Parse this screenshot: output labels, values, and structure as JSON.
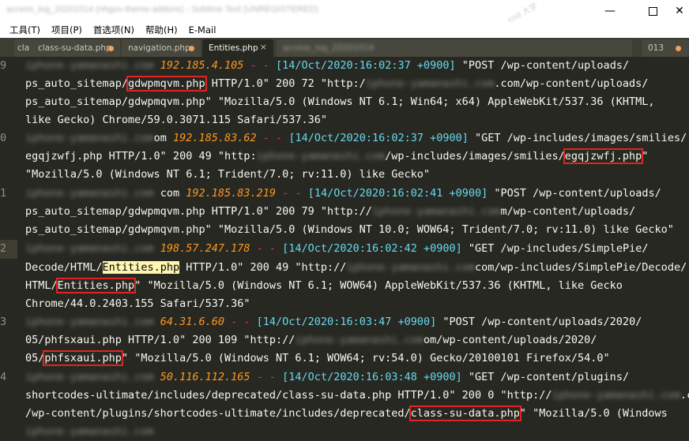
{
  "window": {
    "title": "access_log_20201014 (nhgov-theme-addons) - Sublime Text (UNREGISTERED)",
    "watermark": "ios8 大学"
  },
  "menu": {
    "items": [
      "工具(T)",
      "项目(P)",
      "首选项(N)",
      "帮助(H)",
      "E-Mail"
    ]
  },
  "tabs": [
    {
      "label": "cla",
      "state": "partial"
    },
    {
      "label": "class-su-data.php",
      "state": "modified"
    },
    {
      "label": "navigation.php",
      "state": "modified"
    },
    {
      "label": "Entities.php",
      "state": "active"
    },
    {
      "label": "access_log_20201014",
      "state": "blurred"
    },
    {
      "label": "013",
      "state": "partial"
    }
  ],
  "editor": {
    "line_numbers": [
      "9",
      "0",
      "1",
      "2",
      "3",
      "4"
    ],
    "blurred_host": "iphone-yamanashi.com",
    "entries": [
      {
        "ip": "192.185.4.105",
        "time": "[14/Oct/2020:16:02:37 +0900]",
        "l1_rest": " \"POST /wp-content/uploads/",
        "l2_pre": "ps_auto_sitemap/",
        "l2_box": "gdwpmqvm.php",
        "l2_post": " HTTP/1.0\" 200 72 \"http:/",
        "l2_tail": ".com/wp-content/uploads/",
        "l3": "ps_auto_sitemap/gdwpmqvm.php\" \"Mozilla/5.0 (Windows NT 6.1; Win64; x64) AppleWebKit/537.36 (KHTML,",
        "l4": "like Gecko) Chrome/59.0.3071.115 Safari/537.36\""
      },
      {
        "host_tail": "om",
        "ip": "192.185.83.62",
        "time": "[14/Oct/2020:16:02:37 +0900]",
        "l1_rest": " \"GET /wp-includes/images/smilies/",
        "l2_pre": "egqjzwfj.php HTTP/1.0\" 200 49 \"http:",
        "l2_tail": "/wp-includes/images/smilies/",
        "l2_box": "egqjzwfj.php",
        "l2_post": "\"",
        "l3": "\"Mozilla/5.0 (Windows NT 6.1; Trident/7.0; rv:11.0) like Gecko\""
      },
      {
        "host_tail": "com",
        "ip": "192.185.83.219",
        "time": "[14/Oct/2020:16:02:41 +0900]",
        "l1_rest": " \"POST /wp-content/uploads/",
        "l2_pre": "ps_auto_sitemap/gdwpmqvm.php HTTP/1.0\" 200 79 \"http://",
        "l2_tail": "m/wp-content/uploads/",
        "l3": "ps_auto_sitemap/gdwpmqvm.php\" \"Mozilla/5.0 (Windows NT 10.0; WOW64; Trident/7.0; rv:11.0) like Gecko\""
      },
      {
        "ip": "198.57.247.178",
        "time": "[14/Oct/2020:16:02:42 +0900]",
        "l1_rest": " \"GET /wp-includes/SimplePie/",
        "l2_pre": "Decode/HTML/",
        "l2_sel": "Entities.php",
        "l2_post": " HTTP/1.0\" 200 49 \"http://",
        "l2_tail": "com/wp-includes/SimplePie/Decode/",
        "l3_pre": "HTML/",
        "l3_box": "Entities.php",
        "l3_post": "\" \"Mozilla/5.0 (Windows NT 6.1; WOW64) AppleWebKit/537.36 (KHTML, like Gecko",
        "l4": "Chrome/44.0.2403.155 Safari/537.36\""
      },
      {
        "ip": "64.31.6.60",
        "time": "[14/Oct/2020:16:03:47 +0900]",
        "l1_rest": " \"POST /wp-content/uploads/2020/",
        "l2_pre": "05/phfsxaui.php HTTP/1.0\" 200 109 \"http://",
        "l2_tail": "om/wp-content/uploads/2020/",
        "l3_pre": "05/",
        "l3_box": "phfsxaui.php",
        "l3_post": "\" \"Mozilla/5.0 (Windows NT 6.1; WOW64; rv:54.0) Gecko/20100101 Firefox/54.0\""
      },
      {
        "ip": "50.116.112.165",
        "time": "[14/Oct/2020:16:03:48 +0900]",
        "l1_rest": " \"GET /wp-content/plugins/",
        "l2_pre": "shortcodes-ultimate/includes/deprecated/class-su-data.php HTTP/1.0\" 200 0 \"http://",
        "l2_tail": ".com",
        "l3_pre": "/wp-content/plugins/shortcodes-ultimate/includes/deprecated/",
        "l3_box": "class-su-data.php",
        "l3_post": "\" \"Mozilla/5.0 (Windows"
      }
    ]
  }
}
